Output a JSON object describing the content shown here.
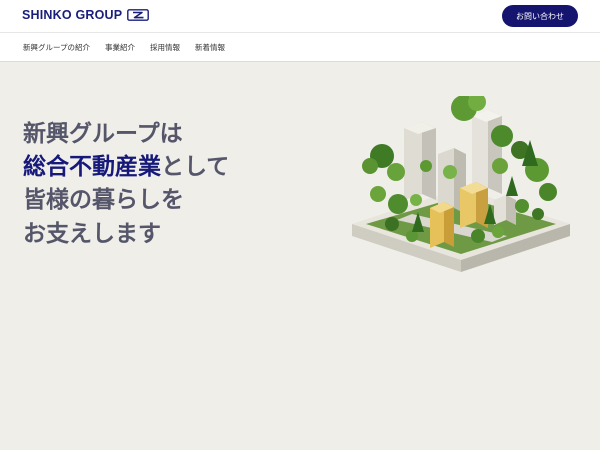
{
  "header": {
    "logo_text": "SHINKO GROUP",
    "logo_icon": "shinko-z-mark",
    "contact_label": "お問い合わせ"
  },
  "nav": {
    "items": [
      {
        "label": "新興グループの紹介"
      },
      {
        "label": "事業紹介"
      },
      {
        "label": "採用情報"
      },
      {
        "label": "新着情報"
      }
    ]
  },
  "hero": {
    "line1": "新興グループは",
    "line2_highlight": "総合不動産業",
    "line2_rest": "として",
    "line3": "皆様の暮らしを",
    "line4": "お支えします",
    "illustration": "isometric-green-city-block"
  },
  "colors": {
    "brand_navy": "#15156f",
    "heading_gray": "#55566a",
    "highlight_navy": "#17197a",
    "background": "#efeee9"
  }
}
